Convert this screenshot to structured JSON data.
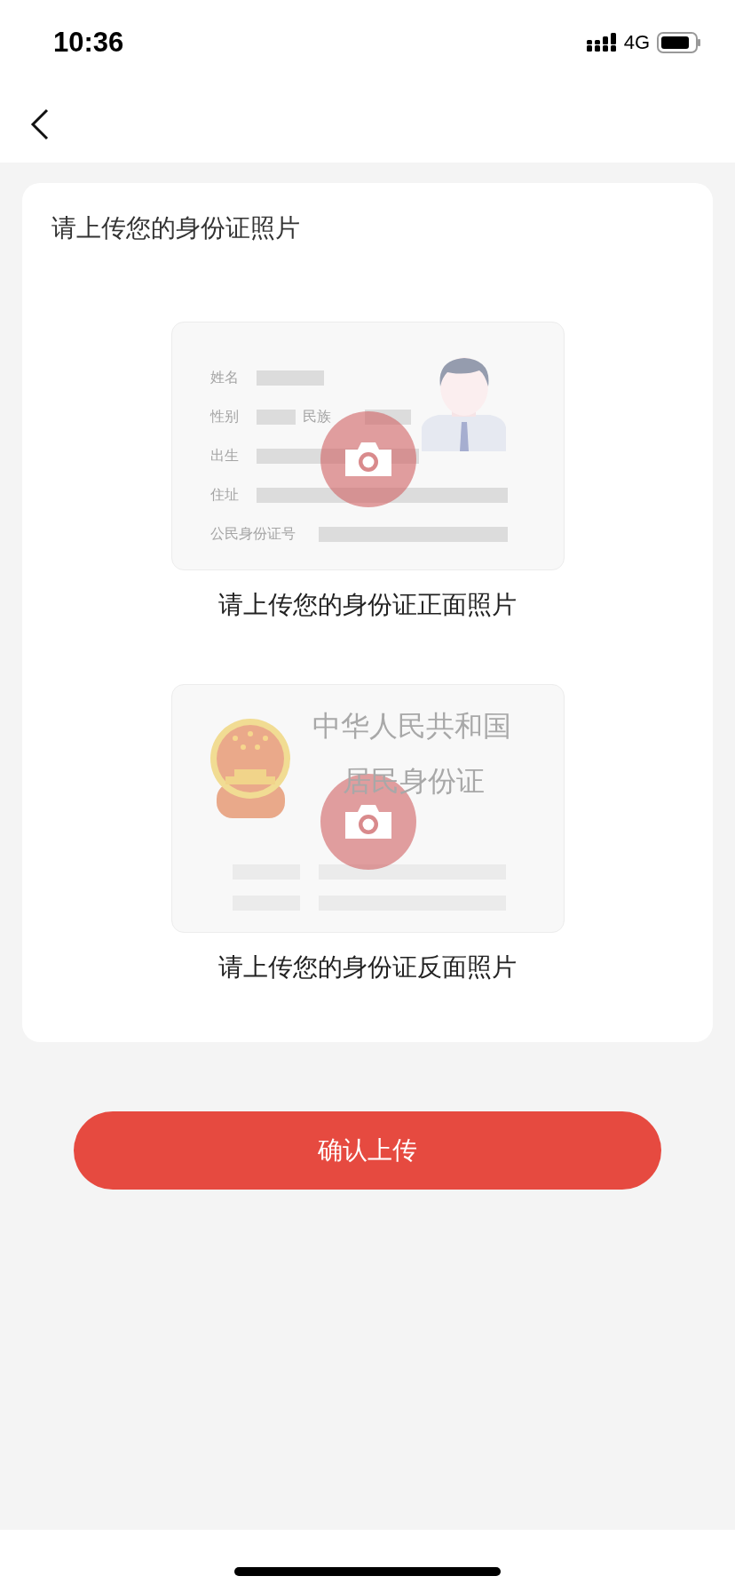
{
  "status_bar": {
    "time": "10:36",
    "network": "4G"
  },
  "card": {
    "title": "请上传您的身份证照片",
    "uploads": [
      {
        "kind": "front",
        "caption": "请上传您的身份证正面照片",
        "labels": [
          "姓名",
          "性别",
          "民族",
          "出生",
          "住址",
          "公民身份证号"
        ]
      },
      {
        "kind": "back",
        "caption": "请上传您的身份证反面照片",
        "labels": [
          "中华人民共和国",
          "居民身份证"
        ]
      }
    ]
  },
  "confirm_button": "确认上传"
}
